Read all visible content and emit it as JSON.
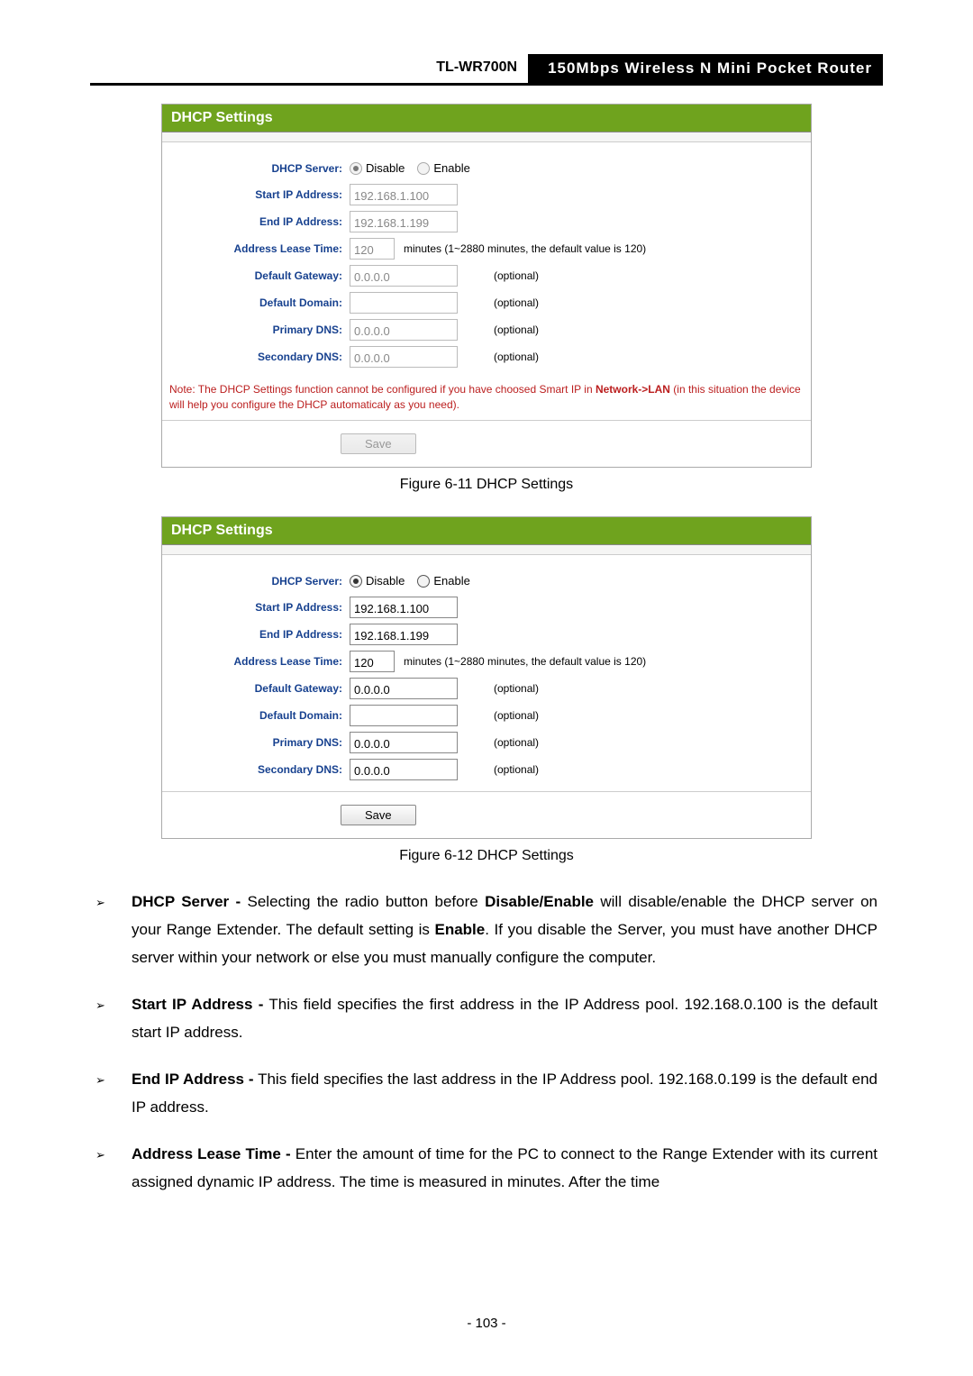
{
  "header": {
    "model": "TL-WR700N",
    "title": "150Mbps  Wireless  N  Mini  Pocket  Router"
  },
  "panel1": {
    "title": "DHCP Settings",
    "labels": {
      "dhcp_server": "DHCP Server:",
      "start_ip": "Start IP Address:",
      "end_ip": "End IP Address:",
      "lease": "Address Lease Time:",
      "gateway": "Default Gateway:",
      "domain": "Default Domain:",
      "pdns": "Primary DNS:",
      "sdns": "Secondary DNS:"
    },
    "radio_disable": "Disable",
    "radio_enable": "Enable",
    "start_ip_val": "192.168.1.100",
    "end_ip_val": "192.168.1.199",
    "lease_val": "120",
    "lease_hint": "minutes (1~2880 minutes, the default value is 120)",
    "gateway_val": "0.0.0.0",
    "domain_val": "",
    "pdns_val": "0.0.0.0",
    "sdns_val": "0.0.0.0",
    "optional": "(optional)",
    "note_a": "Note: The DHCP Settings function cannot be configured if you have choosed Smart IP in ",
    "note_b": "Network->LAN",
    "note_c": " (in this situation the device will help you configure the DHCP automaticaly as you need).",
    "save": "Save"
  },
  "caption1": "Figure 6-11 DHCP Settings",
  "panel2": {
    "title": "DHCP Settings",
    "labels": {
      "dhcp_server": "DHCP Server:",
      "start_ip": "Start IP Address:",
      "end_ip": "End IP Address:",
      "lease": "Address Lease Time:",
      "gateway": "Default Gateway:",
      "domain": "Default Domain:",
      "pdns": "Primary DNS:",
      "sdns": "Secondary DNS:"
    },
    "radio_disable": "Disable",
    "radio_enable": "Enable",
    "start_ip_val": "192.168.1.100",
    "end_ip_val": "192.168.1.199",
    "lease_val": "120",
    "lease_hint": "minutes (1~2880 minutes, the default value is 120)",
    "gateway_val": "0.0.0.0",
    "domain_val": "",
    "pdns_val": "0.0.0.0",
    "sdns_val": "0.0.0.0",
    "optional": "(optional)",
    "save": "Save"
  },
  "caption2": "Figure 6-12 DHCP Settings",
  "desc": {
    "b1": "➢",
    "b2": "➢",
    "b3": "➢",
    "b4": "➢",
    "i1_head": "DHCP Server -",
    "i1_a": " Selecting the radio button before ",
    "i1_b": "Disable/Enable",
    "i1_c": " will disable/enable the DHCP server on your Range Extender. The default setting is ",
    "i1_d": "Enable",
    "i1_e": ". If you disable the Server, you must have another DHCP server within your network or else you must manually configure the computer.",
    "i2_head": "Start IP Address -",
    "i2_a": " This field specifies the first address in the IP Address pool. 192.168.0.100 is the default start IP address.",
    "i3_head": "End IP Address -",
    "i3_a": " This field specifies the last address in the IP Address pool. 192.168.0.199 is the default end IP address.",
    "i4_head": "Address Lease Time -",
    "i4_a": " Enter the amount of time for the PC to connect to the Range Extender with its current assigned dynamic IP address. The time is measured in minutes. After the time"
  },
  "page_number": "- 103 -"
}
